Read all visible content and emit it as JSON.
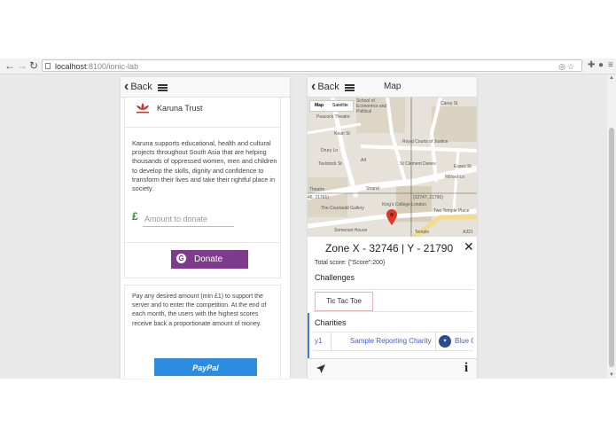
{
  "browser": {
    "url_host": "localhost",
    "url_path": ":8100/ionic-lab"
  },
  "left_panel": {
    "back_label": "Back",
    "org_name": "Karuna Trust",
    "description": "Karuna supports educational, health and cultural projects throughout South Asia that are helping thousands of oppressed women, men and children to develop the skills, dignity and confidence to transform their lives and take their rightful place in society.",
    "currency_symbol": "£",
    "amount_placeholder": "Amount to donate",
    "donate_label": "Donate",
    "donate_color": "#7e3a8c",
    "pay_description": "Pay any desired amount (min £1) to support the server and to enter the competition. At the end of each month, the users with the highest scores receive back a proportionate amount of money.",
    "paypal_label": "PayPal",
    "paypal_color": "#2c8de0"
  },
  "right_panel": {
    "back_label": "Back",
    "title": "Map",
    "map": {
      "type_map": "Map",
      "type_satellite": "Satellite",
      "labels": [
        "Peacock Theatre",
        "School of Economics and Political",
        "Carey St",
        "Royal Courts of Justice",
        "St Clement Danes",
        "Kean St",
        "Drury Ln",
        "Tavistock St",
        "Strand",
        "Essex St",
        "Milford Ln",
        "(32747, 21790)",
        "46, 21791)",
        "The Courtauld Gallery",
        "King's College London",
        "Two Temple Place",
        "Theatre",
        "Somerset House",
        "Temple",
        "A321",
        "A4"
      ],
      "marker_color": "#d93a2b"
    },
    "zone_title": "Zone X - 32746 | Y - 21790",
    "close_label": "✕",
    "total_score": "Total score: {\"Score\":200}",
    "challenges_heading": "Challenges",
    "challenges": [
      "Tic Tac Toe"
    ],
    "charities_heading": "Charities",
    "charities": [
      "y1",
      "Sample Reporting Charity",
      "Blue Cr"
    ]
  }
}
